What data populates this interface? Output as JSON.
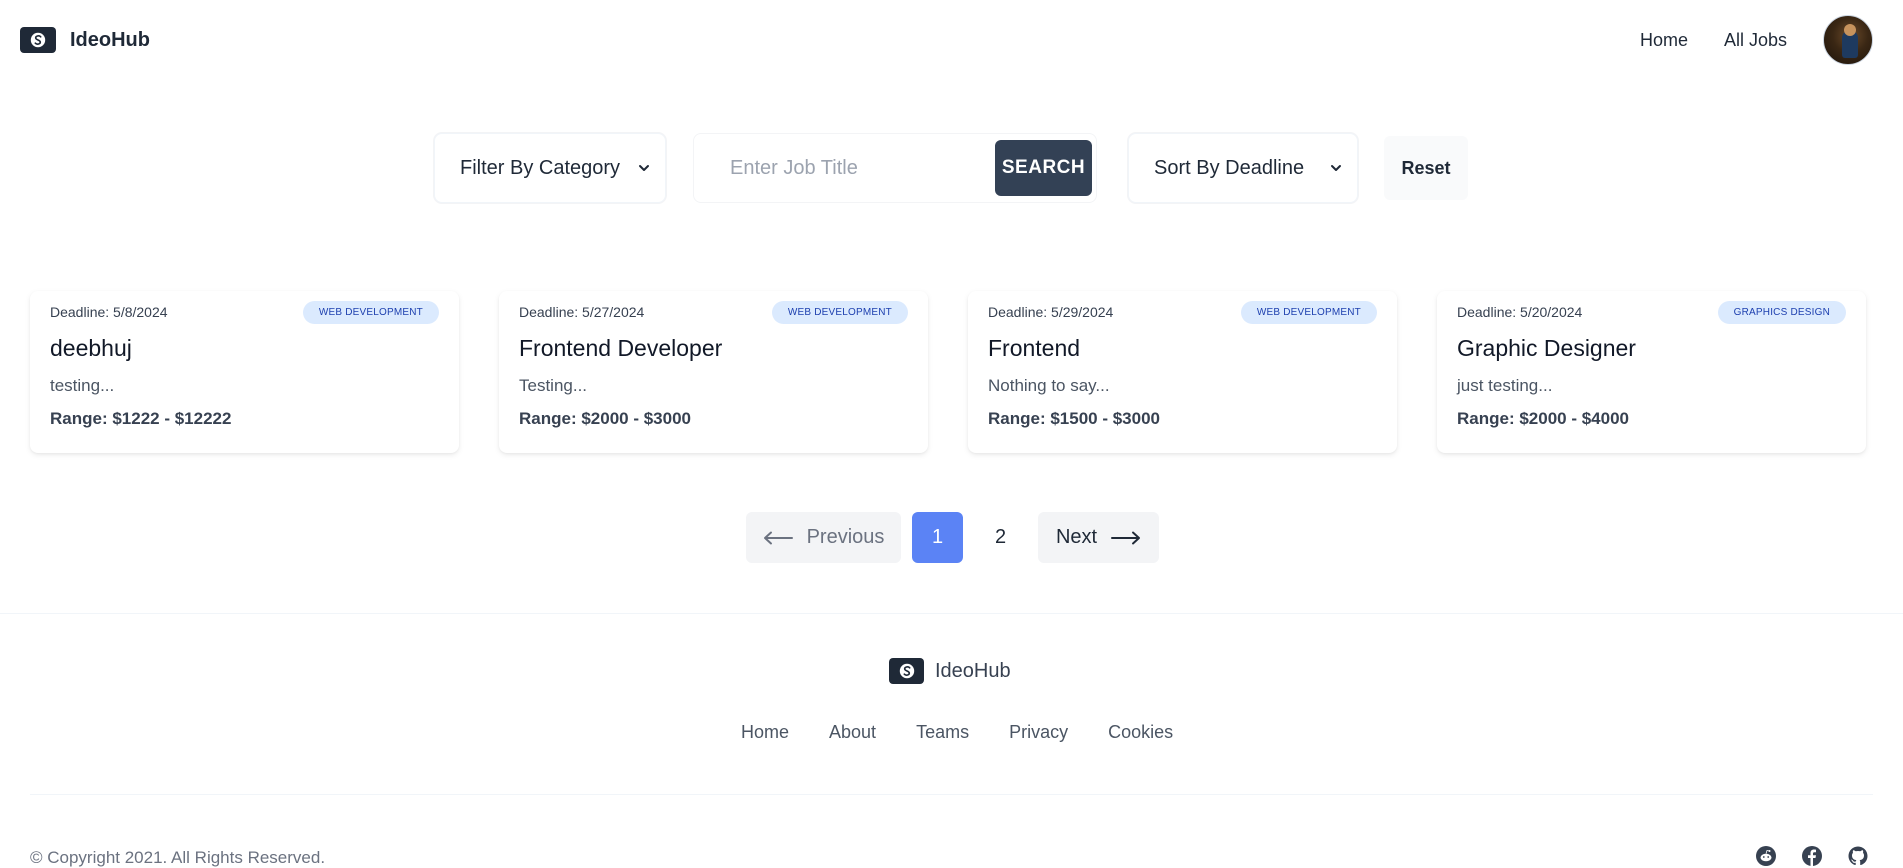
{
  "nav": {
    "brand": "IdeoHub",
    "links": [
      "Home",
      "All Jobs"
    ]
  },
  "filters": {
    "category_label": "Filter By Category",
    "search_placeholder": "Enter Job Title",
    "search_button": "SEARCH",
    "sort_label": "Sort By Deadline",
    "reset_button": "Reset"
  },
  "jobs": [
    {
      "deadline": "Deadline: 5/8/2024",
      "category": "WEB DEVELOPMENT",
      "title": "deebhuj",
      "description": "testing...",
      "range": "Range: $1222 - $12222"
    },
    {
      "deadline": "Deadline: 5/27/2024",
      "category": "WEB DEVELOPMENT",
      "title": "Frontend Developer",
      "description": "Testing...",
      "range": "Range: $2000 - $3000"
    },
    {
      "deadline": "Deadline: 5/29/2024",
      "category": "WEB DEVELOPMENT",
      "title": "Frontend",
      "description": "Nothing to say...",
      "range": "Range: $1500 - $3000"
    },
    {
      "deadline": "Deadline: 5/20/2024",
      "category": "GRAPHICS DESIGN",
      "title": "Graphic Designer",
      "description": "just testing...",
      "range": "Range: $2000 - $4000"
    }
  ],
  "pagination": {
    "previous": "Previous",
    "pages": [
      "1",
      "2"
    ],
    "current": "1",
    "next": "Next"
  },
  "footer": {
    "brand": "IdeoHub",
    "links": [
      "Home",
      "About",
      "Teams",
      "Privacy",
      "Cookies"
    ],
    "copyright": "© Copyright 2021. All Rights Reserved.",
    "social_icons": [
      "reddit-icon",
      "facebook-icon",
      "github-icon"
    ]
  },
  "colors": {
    "primary_dark": "#334155",
    "accent_blue": "#5b83f5",
    "badge_bg": "#dbeafe"
  }
}
